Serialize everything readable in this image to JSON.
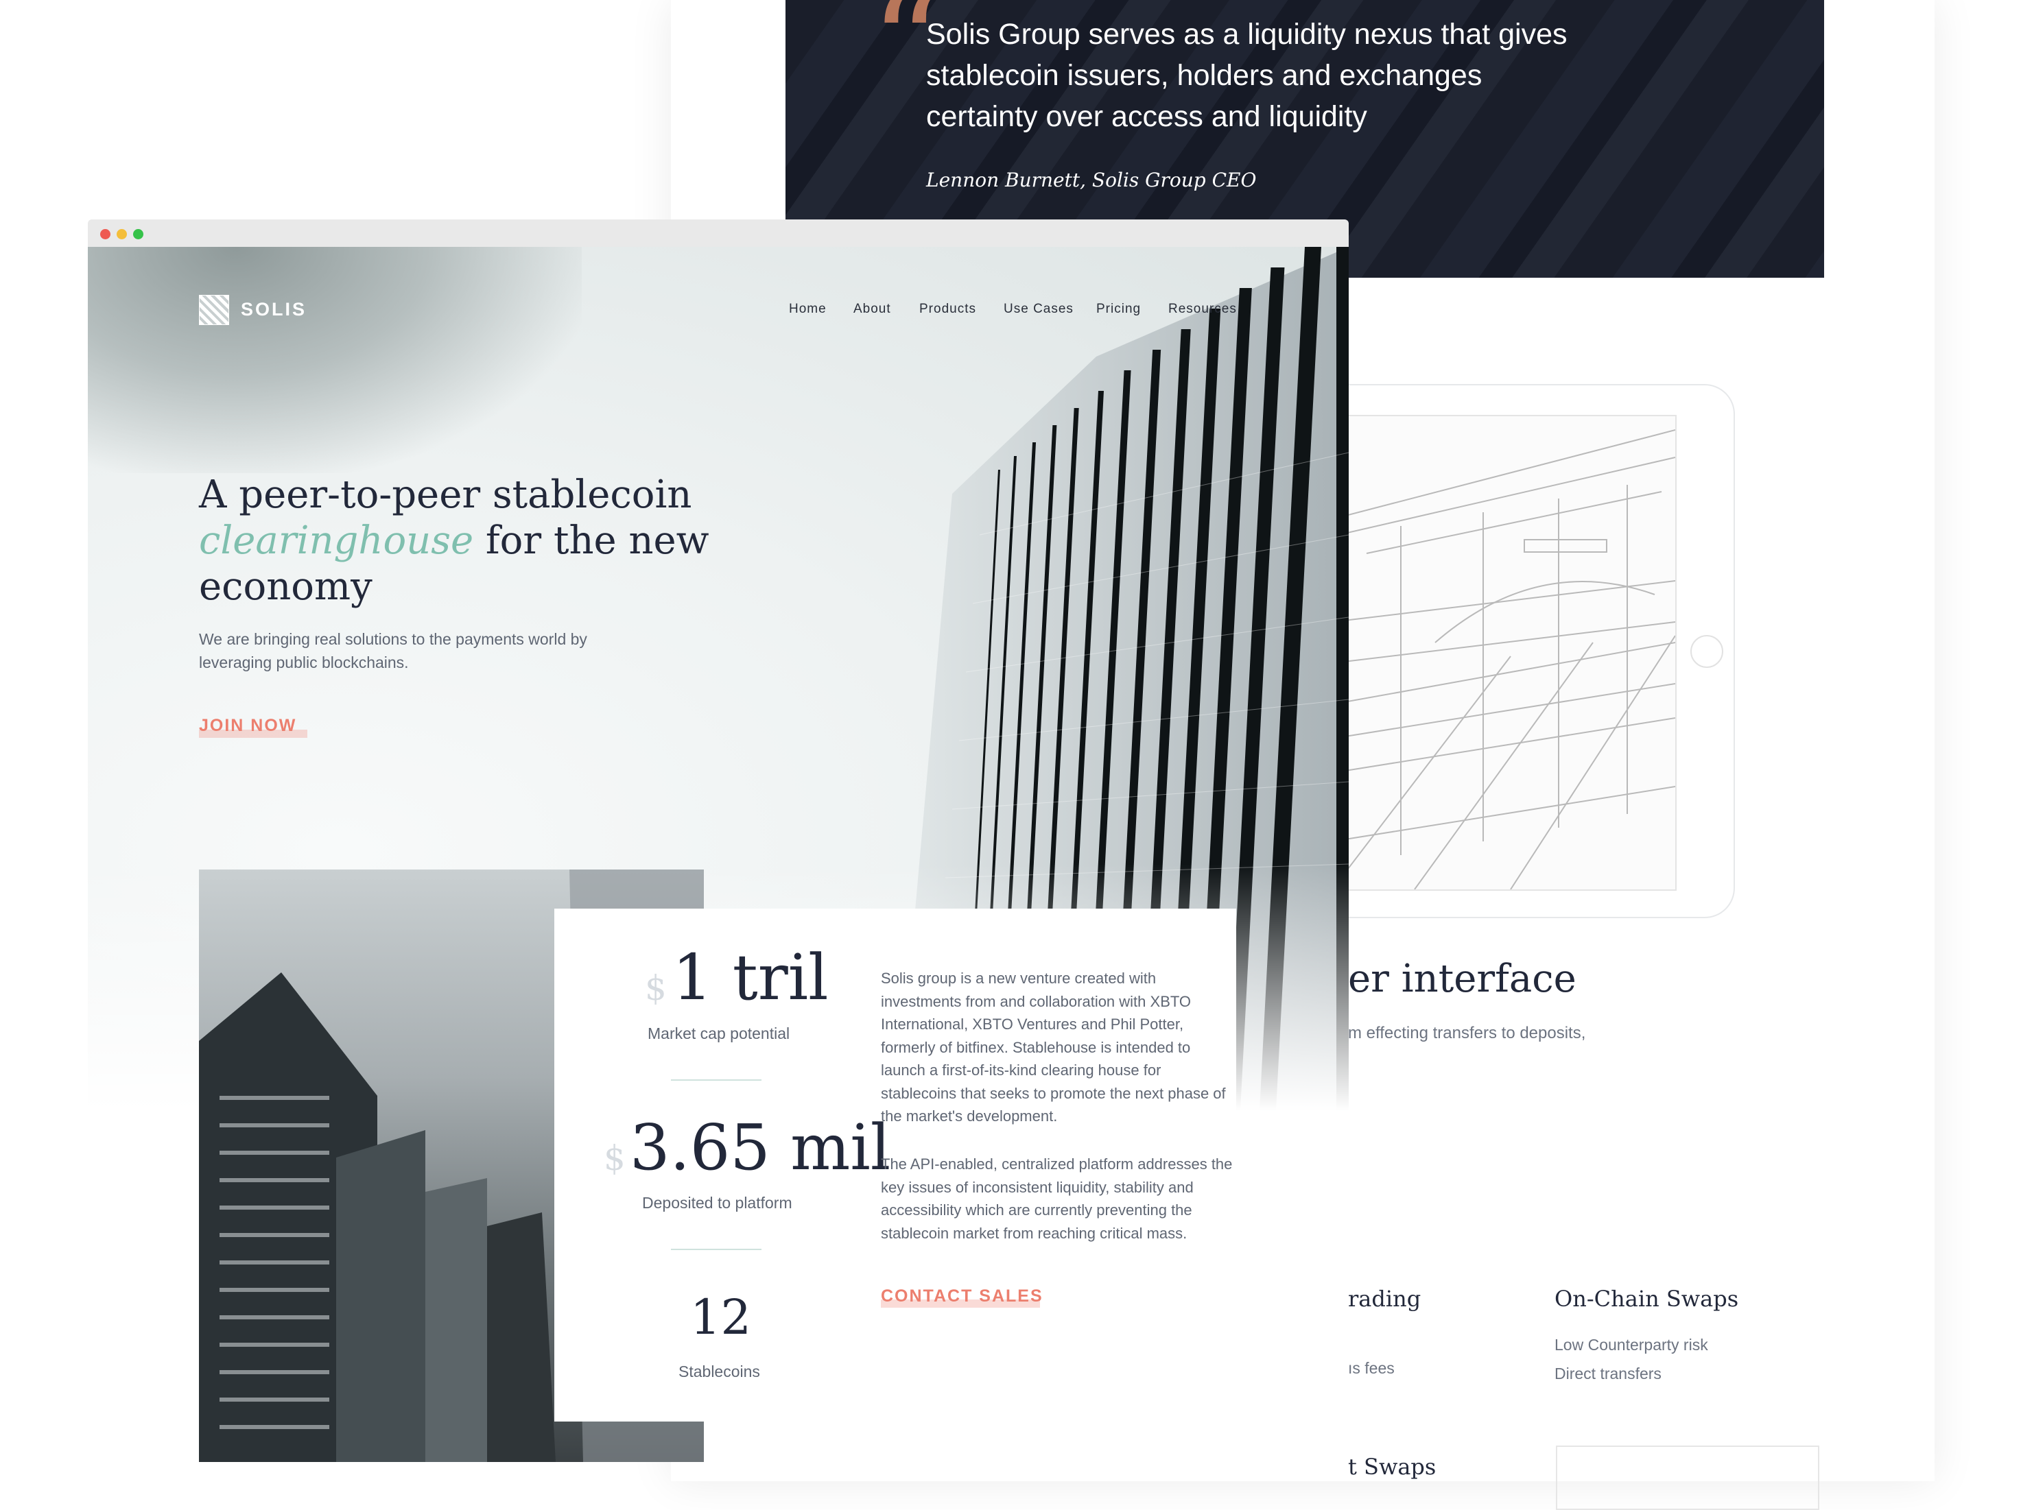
{
  "quote": {
    "text": "Solis Group serves as a liquidity nexus that gives stablecoin issuers, holders and exchanges certainty over access and liquidity",
    "author": "Lennon Burnett, Solis Group CEO"
  },
  "interface_section": {
    "heading": "er interface",
    "subtext": "m effecting transfers to deposits,"
  },
  "features": [
    {
      "title": "rading",
      "items": [
        "ıs fees"
      ]
    },
    {
      "title": "On-Chain Swaps",
      "items": [
        "Low Counterparty risk",
        "Direct transfers"
      ]
    },
    {
      "title": "t Swaps",
      "items": []
    }
  ],
  "nav": {
    "logo": "SOLIS",
    "links": [
      "Home",
      "About",
      "Products",
      "Use Cases",
      "Pricing",
      "Resources"
    ]
  },
  "hero": {
    "title_line1": "A peer-to-peer stablecoin",
    "title_em": "clearinghouse",
    "title_rest": " for the new economy",
    "description": "We are bringing real solutions to the payments world by leveraging public blockchains.",
    "cta": "JOIN NOW"
  },
  "stats": [
    {
      "currency": "$",
      "value": "1 tril",
      "label": "Market cap potential"
    },
    {
      "currency": "$",
      "value": "3.65 mil",
      "label": "Deposited to platform"
    },
    {
      "currency": "",
      "value": "12",
      "label": "Stablecoins"
    }
  ],
  "about": {
    "paragraph1": "Solis group is a new venture created with investments from and collaboration with XBTO International, XBTO Ventures and Phil Potter, formerly of bitfinex. Stablehouse is intended to launch a first-of-its-kind clearing house for stablecoins that seeks to promote the next phase of the market's development.",
    "paragraph2": "The API-enabled, centralized platform addresses the key issues of inconsistent liquidity, stability and accessibility which are currently preventing the stablecoin market from reaching critical mass.",
    "cta": "CONTACT SALES"
  },
  "colors": {
    "accent_coral": "#ec7f6e",
    "accent_teal": "#7fbfae",
    "text_dark": "#22283a",
    "traffic_red": "#ee5a52",
    "traffic_yellow": "#f4be3b",
    "traffic_green": "#35c249"
  }
}
